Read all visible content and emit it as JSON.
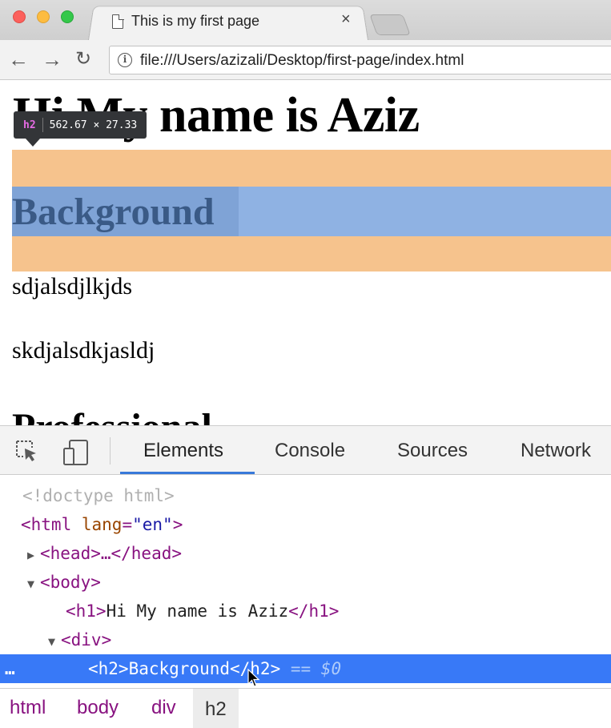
{
  "browser": {
    "tab_title": "This is my first page",
    "tab_close": "×",
    "url": "file:///Users/azizali/Desktop/first-page/index.html",
    "nav": {
      "back": "←",
      "forward": "→",
      "reload": "↻",
      "info": "i"
    }
  },
  "page": {
    "h1": "Hi My name is Aziz",
    "h2": "Background",
    "paragraphs": [
      "sdjalsdjlkjds",
      "skdjalsdkjasldj"
    ],
    "h2_next": "Professional",
    "tooltip": {
      "tag": "h2",
      "size": "562.67 × 27.33"
    },
    "colors": {
      "margin": "#f6c38d",
      "content": "#8fb2e3"
    }
  },
  "devtools": {
    "tabs": [
      "Elements",
      "Console",
      "Sources",
      "Network"
    ],
    "active_tab": "Elements",
    "dom": {
      "doctype": "<!doctype html>",
      "html_open": "<html",
      "html_attr": "lang",
      "html_attr_eq": "=",
      "html_attr_val": "\"en\"",
      "html_close": ">",
      "head": "<head>…</head>",
      "body_open": "<body>",
      "h1_open": "<h1>",
      "h1_text": "Hi My name is Aziz",
      "h1_close": "</h1>",
      "div_open": "<div>",
      "selected_line": "<h2>Background</h2>",
      "selected_marker": "== $0",
      "dots": "…"
    },
    "breadcrumbs": [
      "html",
      "body",
      "div",
      "h2"
    ],
    "accent": "#3879f7"
  }
}
